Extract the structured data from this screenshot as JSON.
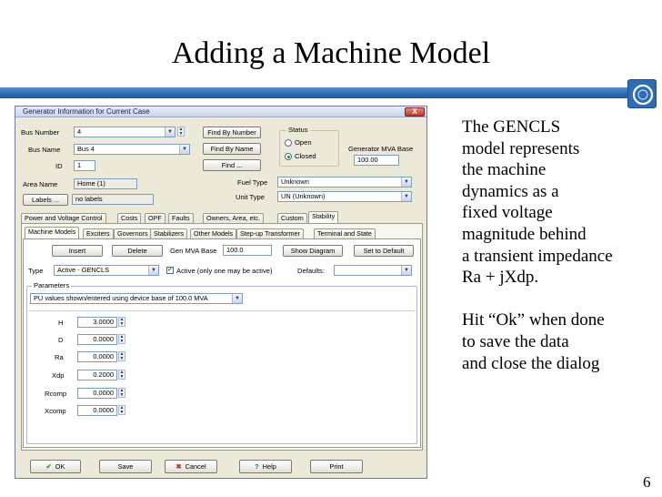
{
  "slide": {
    "title": "Adding a Machine Model",
    "page_number": "6",
    "body_lines": [
      "The GENCLS",
      "model represents",
      "the machine",
      "dynamics as a",
      "fixed voltage",
      "magnitude behind",
      "a transient impedance",
      "Ra + jXdp.",
      "",
      "Hit “Ok” when done",
      "to save the data",
      "and close the dialog"
    ]
  },
  "dialog": {
    "title": "Generator Information for Current Case",
    "close_glyph": "X",
    "bus_number_label": "Bus Number",
    "bus_number_value": "4",
    "bus_name_label": "Bus Name",
    "bus_name_value": "Bus 4",
    "id_label": "ID",
    "id_value": "1",
    "area_name_label": "Area Name",
    "area_name_value": "Home (1)",
    "labels_button": "Labels ...",
    "labels_value": "no labels",
    "find_by_number": "Find By Number",
    "find_by_name": "Find By Name",
    "find": "Find ...",
    "status_label": "Status",
    "status_open": "Open",
    "status_closed": "Closed",
    "mva_base_label": "Generator MVA Base",
    "mva_base_value": "100.00",
    "fuel_type_label": "Fuel Type",
    "fuel_type_value": "Unknown",
    "unit_type_label": "Unit Type",
    "unit_type_value": "UN (Unknown)",
    "tabs": [
      "Power and Voltage Control",
      "Costs",
      "OPF",
      "Faults",
      "Owners, Area, etc.",
      "Custom",
      "Stability"
    ],
    "subtabs": [
      "Machine Models",
      "Exciters",
      "Governors",
      "Stabilizers",
      "Other Models",
      "Step-up Transformer",
      "Terminal and State"
    ],
    "insert_button": "Insert",
    "delete_button": "Delete",
    "gen_mva_base_label": "Gen MVA Base",
    "gen_mva_base_value": "100.0",
    "show_diagram_button": "Show Diagram",
    "set_default_button": "Set to Default",
    "type_label": "Type",
    "type_value": "Active - GENCLS",
    "active_check_label": "Active (only one may be active)",
    "defaults_label": "Defaults:",
    "parameters_label": "Parameters",
    "pu_select_value": "PU values shown/entered using device base of 100.0 MVA",
    "params": [
      {
        "name": "H",
        "value": "3.0000"
      },
      {
        "name": "D",
        "value": "0.0000"
      },
      {
        "name": "Ra",
        "value": "0.0000"
      },
      {
        "name": "Xdp",
        "value": "0.2000"
      },
      {
        "name": "Rcomp",
        "value": "0.0000"
      },
      {
        "name": "Xcomp",
        "value": "0.0000"
      }
    ],
    "ok_button": "OK",
    "save_button": "Save",
    "cancel_button": "Cancel",
    "help_button": "Help",
    "print_button": "Print"
  },
  "colors": {
    "title_rule": "#2f6fb6",
    "dialog_bg": "#ece9d8",
    "ok_icon": "#2a9a2a",
    "cancel_icon": "#c0392b",
    "help_icon": "#2a5fb0"
  }
}
